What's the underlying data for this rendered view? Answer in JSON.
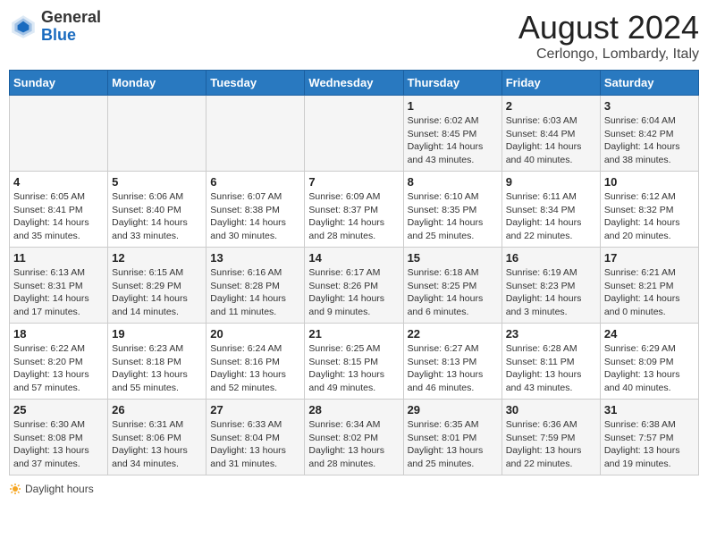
{
  "header": {
    "logo_general": "General",
    "logo_blue": "Blue",
    "title": "August 2024",
    "location": "Cerlongo, Lombardy, Italy"
  },
  "weekdays": [
    "Sunday",
    "Monday",
    "Tuesday",
    "Wednesday",
    "Thursday",
    "Friday",
    "Saturday"
  ],
  "weeks": [
    [
      {
        "day": "",
        "info": ""
      },
      {
        "day": "",
        "info": ""
      },
      {
        "day": "",
        "info": ""
      },
      {
        "day": "",
        "info": ""
      },
      {
        "day": "1",
        "info": "Sunrise: 6:02 AM\nSunset: 8:45 PM\nDaylight: 14 hours and 43 minutes."
      },
      {
        "day": "2",
        "info": "Sunrise: 6:03 AM\nSunset: 8:44 PM\nDaylight: 14 hours and 40 minutes."
      },
      {
        "day": "3",
        "info": "Sunrise: 6:04 AM\nSunset: 8:42 PM\nDaylight: 14 hours and 38 minutes."
      }
    ],
    [
      {
        "day": "4",
        "info": "Sunrise: 6:05 AM\nSunset: 8:41 PM\nDaylight: 14 hours and 35 minutes."
      },
      {
        "day": "5",
        "info": "Sunrise: 6:06 AM\nSunset: 8:40 PM\nDaylight: 14 hours and 33 minutes."
      },
      {
        "day": "6",
        "info": "Sunrise: 6:07 AM\nSunset: 8:38 PM\nDaylight: 14 hours and 30 minutes."
      },
      {
        "day": "7",
        "info": "Sunrise: 6:09 AM\nSunset: 8:37 PM\nDaylight: 14 hours and 28 minutes."
      },
      {
        "day": "8",
        "info": "Sunrise: 6:10 AM\nSunset: 8:35 PM\nDaylight: 14 hours and 25 minutes."
      },
      {
        "day": "9",
        "info": "Sunrise: 6:11 AM\nSunset: 8:34 PM\nDaylight: 14 hours and 22 minutes."
      },
      {
        "day": "10",
        "info": "Sunrise: 6:12 AM\nSunset: 8:32 PM\nDaylight: 14 hours and 20 minutes."
      }
    ],
    [
      {
        "day": "11",
        "info": "Sunrise: 6:13 AM\nSunset: 8:31 PM\nDaylight: 14 hours and 17 minutes."
      },
      {
        "day": "12",
        "info": "Sunrise: 6:15 AM\nSunset: 8:29 PM\nDaylight: 14 hours and 14 minutes."
      },
      {
        "day": "13",
        "info": "Sunrise: 6:16 AM\nSunset: 8:28 PM\nDaylight: 14 hours and 11 minutes."
      },
      {
        "day": "14",
        "info": "Sunrise: 6:17 AM\nSunset: 8:26 PM\nDaylight: 14 hours and 9 minutes."
      },
      {
        "day": "15",
        "info": "Sunrise: 6:18 AM\nSunset: 8:25 PM\nDaylight: 14 hours and 6 minutes."
      },
      {
        "day": "16",
        "info": "Sunrise: 6:19 AM\nSunset: 8:23 PM\nDaylight: 14 hours and 3 minutes."
      },
      {
        "day": "17",
        "info": "Sunrise: 6:21 AM\nSunset: 8:21 PM\nDaylight: 14 hours and 0 minutes."
      }
    ],
    [
      {
        "day": "18",
        "info": "Sunrise: 6:22 AM\nSunset: 8:20 PM\nDaylight: 13 hours and 57 minutes."
      },
      {
        "day": "19",
        "info": "Sunrise: 6:23 AM\nSunset: 8:18 PM\nDaylight: 13 hours and 55 minutes."
      },
      {
        "day": "20",
        "info": "Sunrise: 6:24 AM\nSunset: 8:16 PM\nDaylight: 13 hours and 52 minutes."
      },
      {
        "day": "21",
        "info": "Sunrise: 6:25 AM\nSunset: 8:15 PM\nDaylight: 13 hours and 49 minutes."
      },
      {
        "day": "22",
        "info": "Sunrise: 6:27 AM\nSunset: 8:13 PM\nDaylight: 13 hours and 46 minutes."
      },
      {
        "day": "23",
        "info": "Sunrise: 6:28 AM\nSunset: 8:11 PM\nDaylight: 13 hours and 43 minutes."
      },
      {
        "day": "24",
        "info": "Sunrise: 6:29 AM\nSunset: 8:09 PM\nDaylight: 13 hours and 40 minutes."
      }
    ],
    [
      {
        "day": "25",
        "info": "Sunrise: 6:30 AM\nSunset: 8:08 PM\nDaylight: 13 hours and 37 minutes."
      },
      {
        "day": "26",
        "info": "Sunrise: 6:31 AM\nSunset: 8:06 PM\nDaylight: 13 hours and 34 minutes."
      },
      {
        "day": "27",
        "info": "Sunrise: 6:33 AM\nSunset: 8:04 PM\nDaylight: 13 hours and 31 minutes."
      },
      {
        "day": "28",
        "info": "Sunrise: 6:34 AM\nSunset: 8:02 PM\nDaylight: 13 hours and 28 minutes."
      },
      {
        "day": "29",
        "info": "Sunrise: 6:35 AM\nSunset: 8:01 PM\nDaylight: 13 hours and 25 minutes."
      },
      {
        "day": "30",
        "info": "Sunrise: 6:36 AM\nSunset: 7:59 PM\nDaylight: 13 hours and 22 minutes."
      },
      {
        "day": "31",
        "info": "Sunrise: 6:38 AM\nSunset: 7:57 PM\nDaylight: 13 hours and 19 minutes."
      }
    ]
  ],
  "footer": {
    "daylight_label": "Daylight hours"
  }
}
